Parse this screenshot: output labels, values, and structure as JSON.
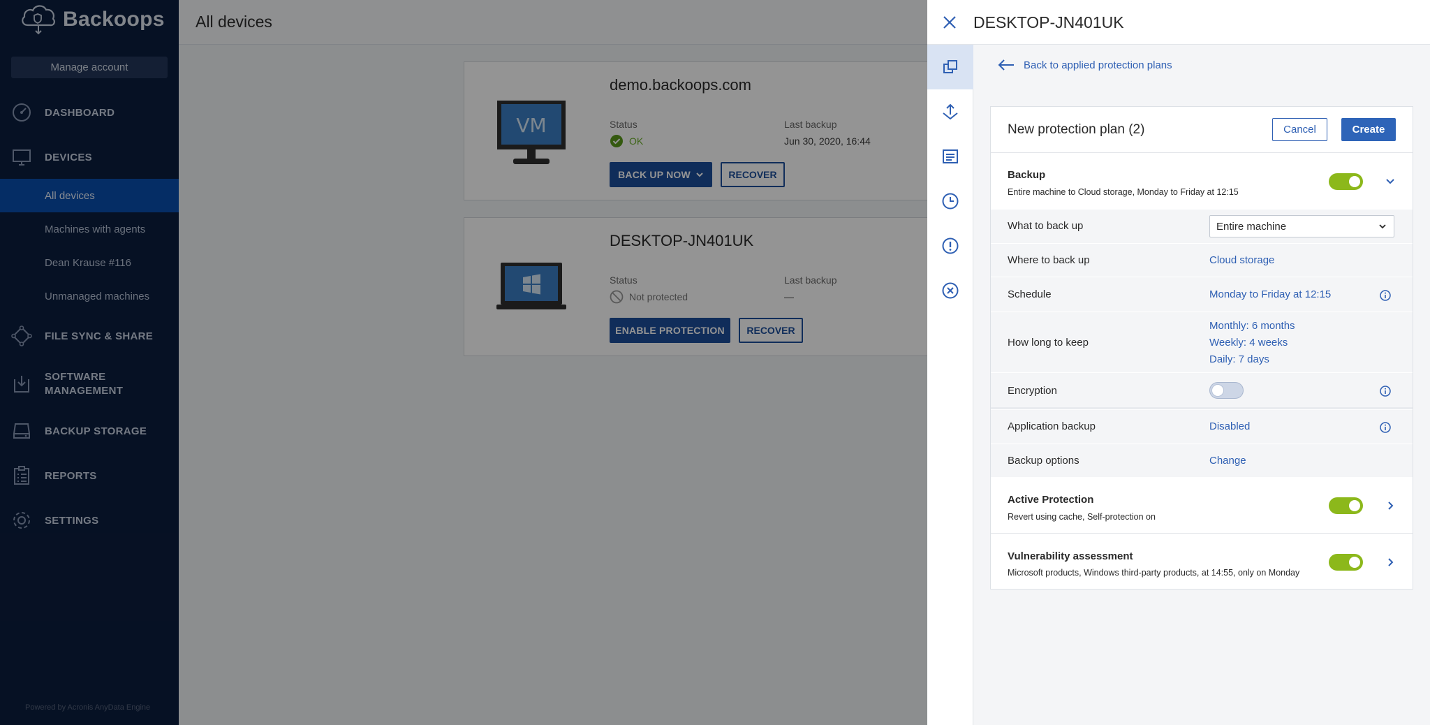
{
  "sidebar": {
    "brand": "Backoops",
    "manage_account": "Manage account",
    "nav": {
      "dashboard": "DASHBOARD",
      "devices": "DEVICES",
      "file_sync": "FILE SYNC & SHARE",
      "software_line1": "SOFTWARE",
      "software_line2": "MANAGEMENT",
      "backup_storage": "BACKUP STORAGE",
      "reports": "REPORTS",
      "settings": "SETTINGS"
    },
    "sub_items": [
      "All devices",
      "Machines with agents",
      "Dean Krause #116",
      "Unmanaged machines"
    ],
    "powered_by": "Powered by Acronis AnyData Engine"
  },
  "main": {
    "title": "All devices",
    "devices": [
      {
        "name": "demo.backoops.com",
        "status_label": "Status",
        "status_value": "OK",
        "last_backup_label": "Last backup",
        "last_backup_value": "Jun 30, 2020, 16:44",
        "primary_button": "BACK UP NOW",
        "secondary_button": "RECOVER",
        "thumbnail_text": "VM"
      },
      {
        "name": "DESKTOP-JN401UK",
        "status_label": "Status",
        "status_value": "Not protected",
        "last_backup_label": "Last backup",
        "last_backup_value": "—",
        "primary_button": "ENABLE PROTECTION",
        "secondary_button": "RECOVER"
      }
    ]
  },
  "panel": {
    "title": "DESKTOP-JN401UK",
    "back_link": "Back to applied protection plans",
    "plan": {
      "title": "New protection plan (2)",
      "cancel": "Cancel",
      "create": "Create",
      "backup": {
        "title": "Backup",
        "subtitle": "Entire machine to Cloud storage, Monday to Friday at 12:15",
        "enabled": true
      },
      "rows": {
        "what_label": "What to back up",
        "what_value": "Entire machine",
        "where_label": "Where to back up",
        "where_value": "Cloud storage",
        "schedule_label": "Schedule",
        "schedule_value": "Monday to Friday at 12:15",
        "keep_label": "How long to keep",
        "keep_monthly": "Monthly: 6 months",
        "keep_weekly": "Weekly: 4 weeks",
        "keep_daily": "Daily: 7 days",
        "encryption_label": "Encryption",
        "encryption_enabled": false,
        "app_backup_label": "Application backup",
        "app_backup_value": "Disabled",
        "options_label": "Backup options",
        "options_value": "Change"
      },
      "active_protection": {
        "title": "Active Protection",
        "subtitle": "Revert using cache, Self-protection on",
        "enabled": true
      },
      "vulnerability": {
        "title": "Vulnerability assessment",
        "subtitle": "Microsoft products, Windows third-party products, at 14:55, only on Monday",
        "enabled": true
      }
    }
  },
  "colors": {
    "sidebar_bg": "#0c1e3e",
    "active_nav": "#0a4eaf",
    "link": "#2e5fb3",
    "toggle_on": "#8cb81b",
    "primary_button": "#1d4f9c"
  }
}
